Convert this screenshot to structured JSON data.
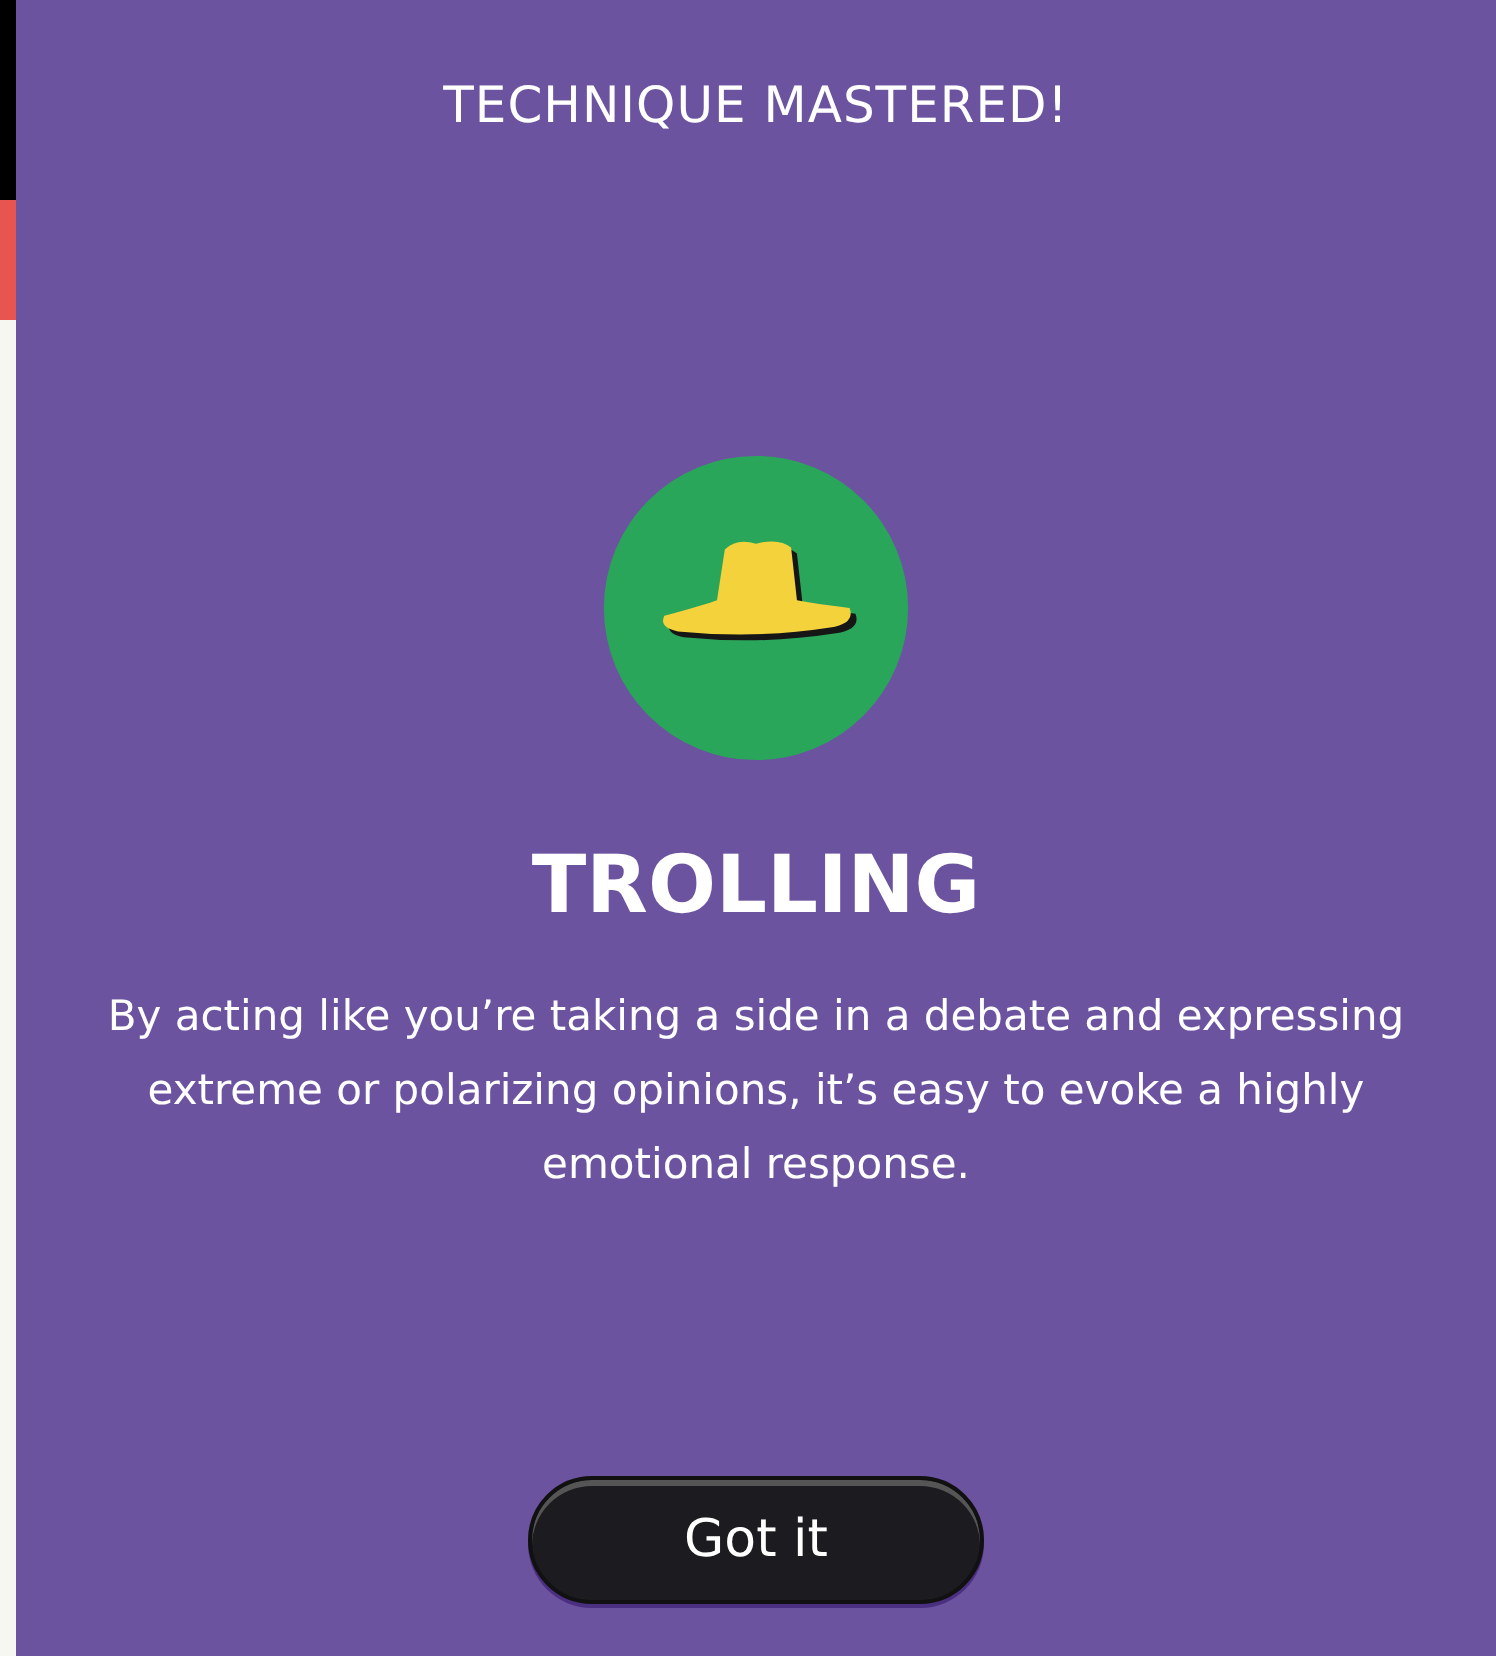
{
  "header": {
    "title": "TECHNIQUE MASTERED!"
  },
  "technique": {
    "name": "TROLLING",
    "description": "By acting like you’re taking a side in a debate and expressing extreme or polarizing opinions, it’s easy to evoke a highly emotional response."
  },
  "buttons": [
    {
      "label": "Got it"
    }
  ]
}
